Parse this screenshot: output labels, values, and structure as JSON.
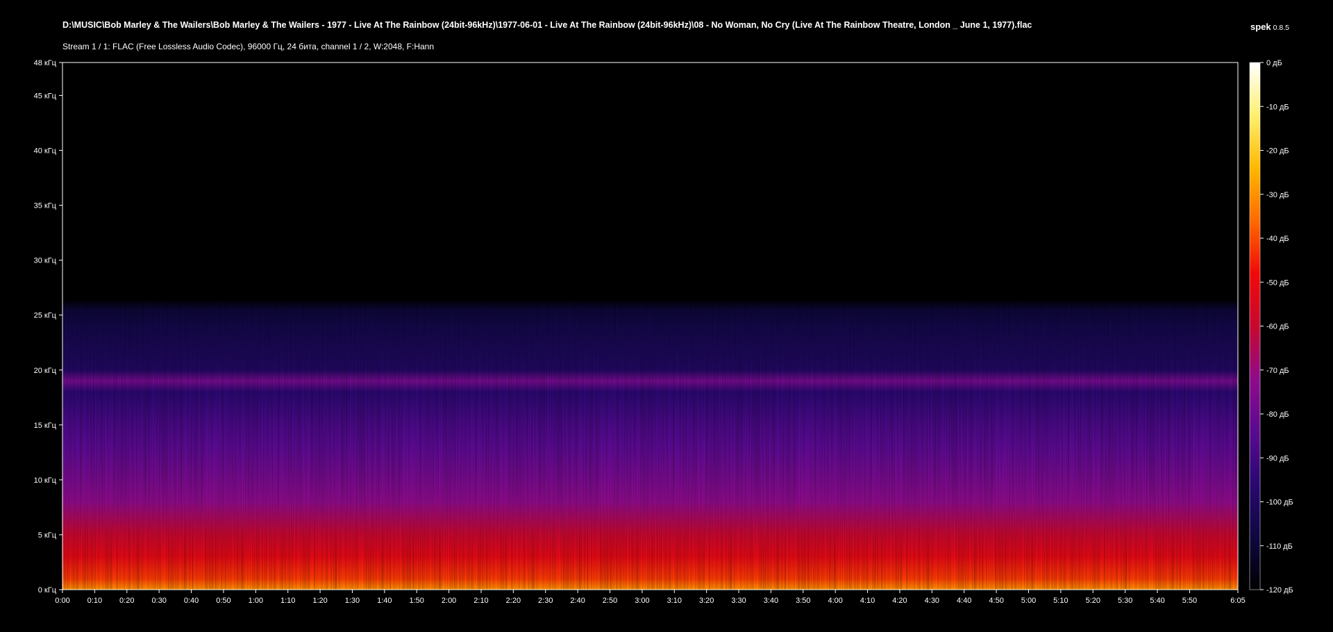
{
  "file_path": "D:\\MUSIC\\Bob Marley & The Wailers\\Bob Marley & The Wailers - 1977 - Live At The Rainbow  (24bit-96kHz)\\1977-06-01 - Live At The Rainbow (24bit-96kHz)\\08 - No Woman, No Cry (Live At The Rainbow Theatre, London _ June 1, 1977).flac",
  "stream_info": "Stream 1 / 1: FLAC (Free Lossless Audio Codec), 96000 Гц, 24 бита, channel 1 / 2, W:2048, F:Hann",
  "app": {
    "name": "spek",
    "version": "0.8.5"
  },
  "chart_data": {
    "type": "heatmap",
    "title": "",
    "x": {
      "unit": "time",
      "min_seconds": 0,
      "max_seconds": 365,
      "tick_labels": [
        "0:00",
        "0:10",
        "0:20",
        "0:30",
        "0:40",
        "0:50",
        "1:00",
        "1:10",
        "1:20",
        "1:30",
        "1:40",
        "1:50",
        "2:00",
        "2:10",
        "2:20",
        "2:30",
        "2:40",
        "2:50",
        "3:00",
        "3:10",
        "3:20",
        "3:30",
        "3:40",
        "3:50",
        "4:00",
        "4:10",
        "4:20",
        "4:30",
        "4:40",
        "4:50",
        "5:00",
        "5:10",
        "5:20",
        "5:30",
        "5:40",
        "5:50",
        "6:05"
      ],
      "tick_seconds": [
        0,
        10,
        20,
        30,
        40,
        50,
        60,
        70,
        80,
        90,
        100,
        110,
        120,
        130,
        140,
        150,
        160,
        170,
        180,
        190,
        200,
        210,
        220,
        230,
        240,
        250,
        260,
        270,
        280,
        290,
        300,
        310,
        320,
        330,
        340,
        350,
        365
      ]
    },
    "y": {
      "unit": "kHz",
      "min": 0,
      "max": 48,
      "tick_labels": [
        "0 кГц",
        "5 кГц",
        "10 кГц",
        "15 кГц",
        "20 кГц",
        "25 кГц",
        "30 кГц",
        "35 кГц",
        "40 кГц",
        "45 кГц",
        "48 кГц"
      ],
      "tick_values": [
        0,
        5,
        10,
        15,
        20,
        25,
        30,
        35,
        40,
        45,
        48
      ]
    },
    "colorbar": {
      "unit": "dB",
      "min": -120,
      "max": 0,
      "tick_labels": [
        "0 дБ",
        "-10 дБ",
        "-20 дБ",
        "-30 дБ",
        "-40 дБ",
        "-50 дБ",
        "-60 дБ",
        "-70 дБ",
        "-80 дБ",
        "-90 дБ",
        "-100 дБ",
        "-110 дБ",
        "-120 дБ"
      ],
      "tick_values": [
        0,
        -10,
        -20,
        -30,
        -40,
        -50,
        -60,
        -70,
        -80,
        -90,
        -100,
        -110,
        -120
      ],
      "colors": [
        "#000000",
        "#0e0840",
        "#2a0870",
        "#5a0a90",
        "#8e0b8a",
        "#c8082e",
        "#f00a08",
        "#ff6a00",
        "#ffb800",
        "#fff070",
        "#ffffff"
      ]
    },
    "spectral_profile": {
      "freq_khz": [
        0,
        1,
        3,
        5,
        8,
        10,
        13,
        15,
        18,
        19,
        20,
        22,
        24,
        25.5,
        26.5,
        48
      ],
      "level_db": [
        -30,
        -42,
        -52,
        -60,
        -72,
        -77,
        -84,
        -88,
        -96,
        -78,
        -100,
        -103,
        -106,
        -110,
        -120,
        -120
      ]
    },
    "grid": false,
    "legend": "right"
  }
}
